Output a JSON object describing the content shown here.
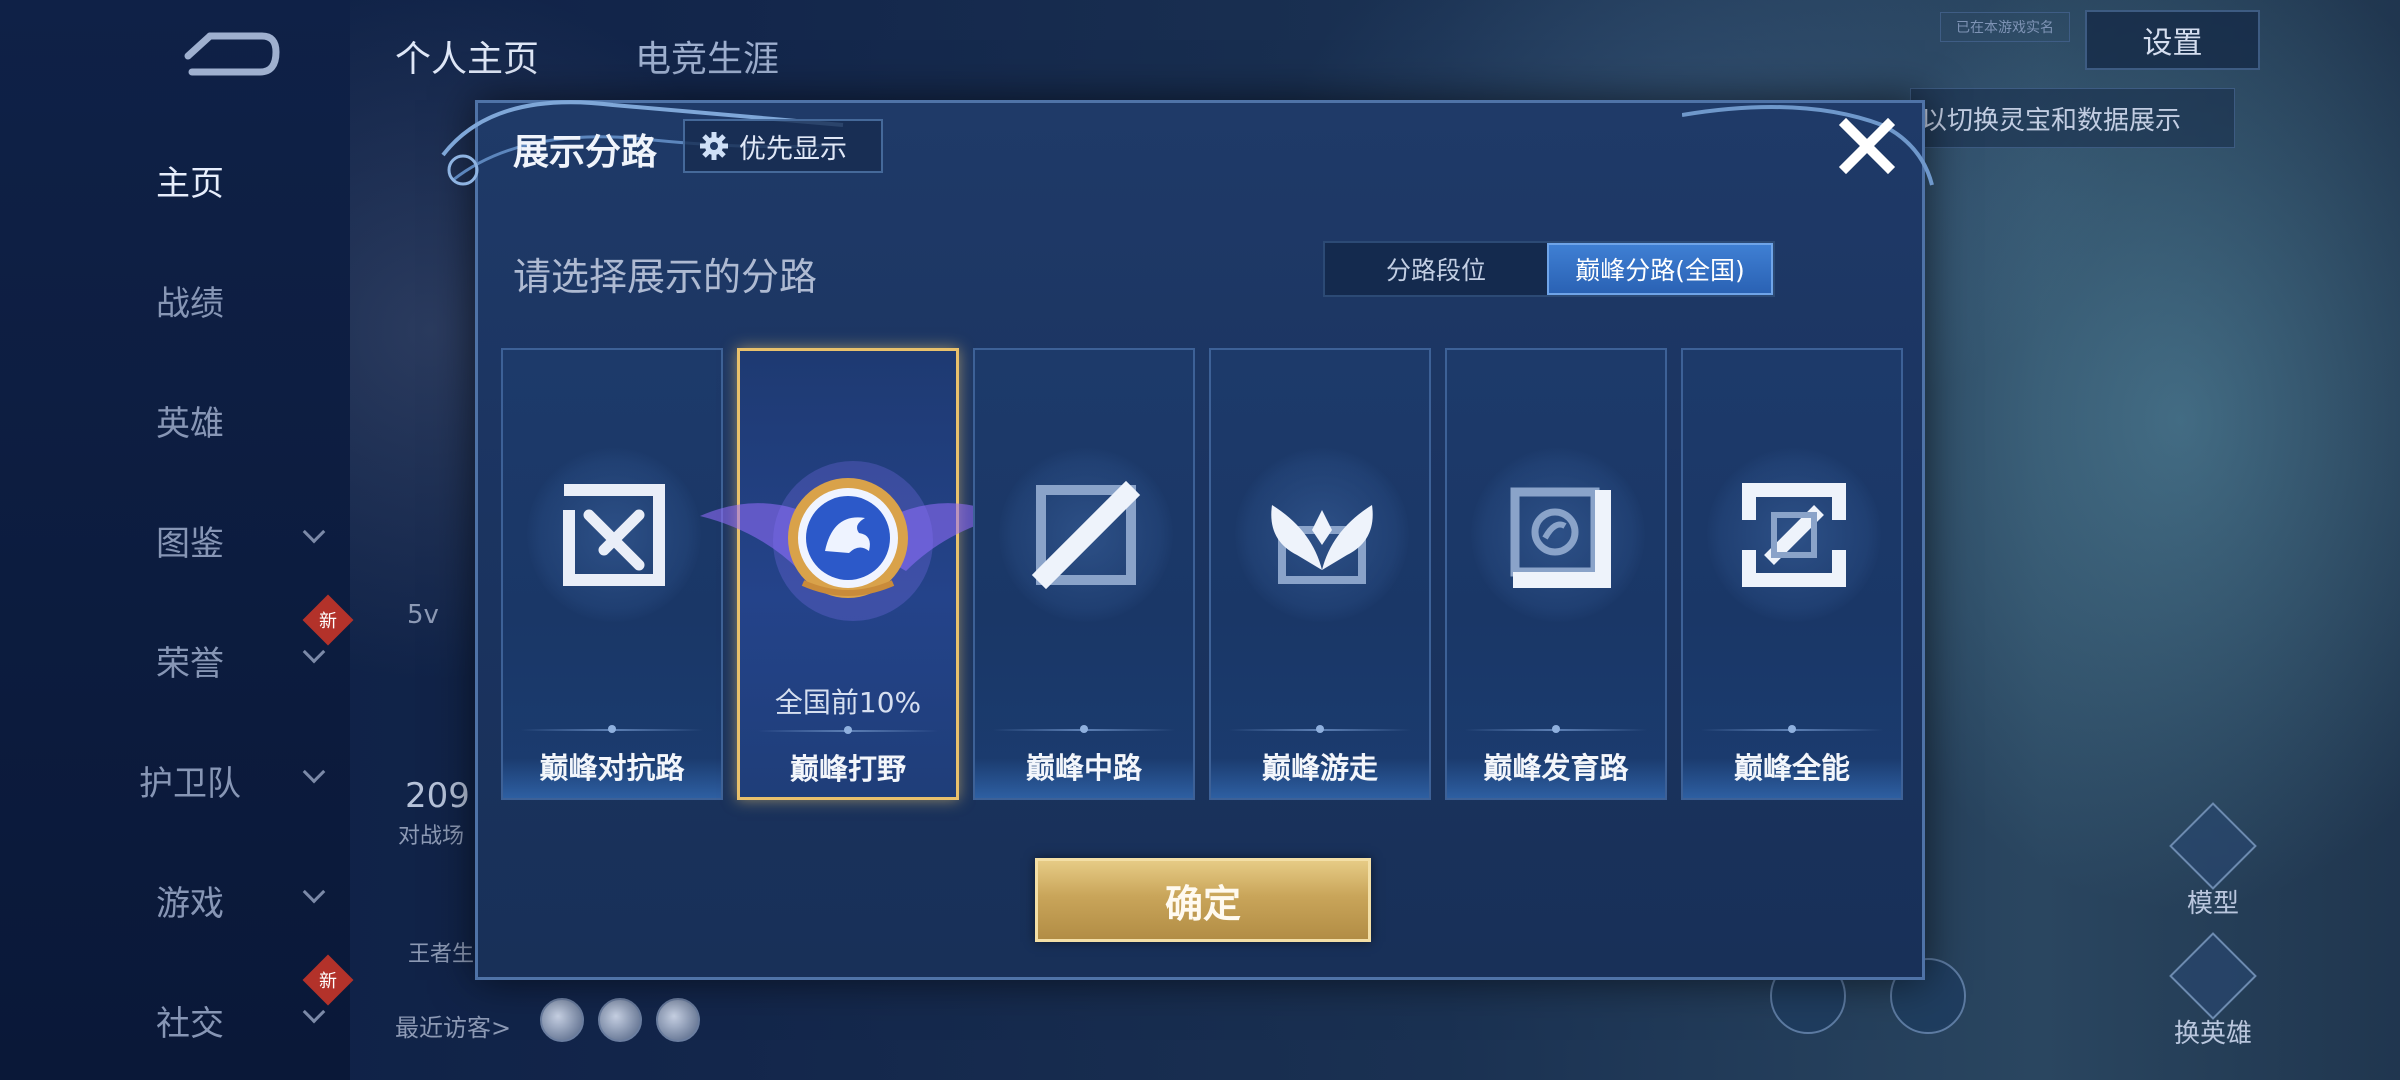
{
  "background": {
    "top_tabs": [
      {
        "label": "个人主页",
        "active": true
      },
      {
        "label": "电竞生涯",
        "active": false
      }
    ],
    "sidebar": [
      {
        "label": "主页",
        "active": true,
        "chevron": false,
        "badge": ""
      },
      {
        "label": "战绩",
        "active": false,
        "chevron": false,
        "badge": ""
      },
      {
        "label": "英雄",
        "active": false,
        "chevron": false,
        "badge": ""
      },
      {
        "label": "图鉴",
        "active": false,
        "chevron": true,
        "badge": ""
      },
      {
        "label": "荣誉",
        "active": false,
        "chevron": true,
        "badge": "新"
      },
      {
        "label": "护卫队",
        "active": false,
        "chevron": true,
        "badge": ""
      },
      {
        "label": "游戏",
        "active": false,
        "chevron": true,
        "badge": ""
      },
      {
        "label": "社交",
        "active": false,
        "chevron": true,
        "badge": "新"
      }
    ],
    "settings_label": "设置",
    "top_hint": "已在本游戏实名",
    "switch_hint": "以切换灵宝和数据展示",
    "model_label": "模型",
    "change_hero_label": "换英雄",
    "recent_visitors_label": "最近访客>",
    "stat_number": "209",
    "stat_caption": "对战场",
    "stat_small": "5v",
    "king_label": "王者生"
  },
  "modal": {
    "title": "展示分路",
    "priority_label": "优先显示",
    "subtitle": "请选择展示的分路",
    "segments": [
      {
        "label": "分路段位",
        "active": false
      },
      {
        "label": "巅峰分路(全国)",
        "active": true
      }
    ],
    "cards": [
      {
        "label": "巅峰对抗路",
        "icon": "clash-lane-icon",
        "selected": false,
        "rank": ""
      },
      {
        "label": "巅峰打野",
        "icon": "jungle-dragon-emblem-icon",
        "selected": true,
        "rank": "全国前10%"
      },
      {
        "label": "巅峰中路",
        "icon": "mid-lane-icon",
        "selected": false,
        "rank": ""
      },
      {
        "label": "巅峰游走",
        "icon": "roam-wings-icon",
        "selected": false,
        "rank": ""
      },
      {
        "label": "巅峰发育路",
        "icon": "farm-lane-icon",
        "selected": false,
        "rank": ""
      },
      {
        "label": "巅峰全能",
        "icon": "all-round-icon",
        "selected": false,
        "rank": ""
      }
    ],
    "confirm_label": "确定",
    "colors": {
      "accent_gold": "#e9c16c",
      "segment_active": "#3f7fd3",
      "panel": "#1f3a68"
    }
  }
}
